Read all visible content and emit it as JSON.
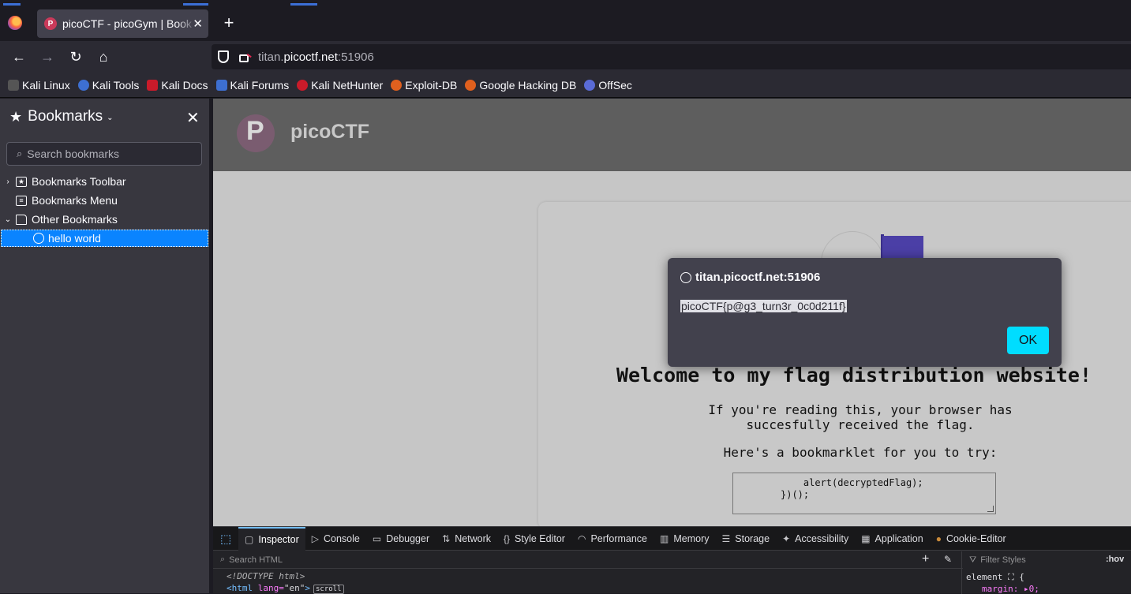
{
  "tab": {
    "title": "picoCTF - picoGym | Book",
    "favicon_letter": "P",
    "close": "✕"
  },
  "newtab": "+",
  "nav": {
    "back": "←",
    "forward": "→",
    "reload": "↻",
    "home": "⌂"
  },
  "urlbar": {
    "host_prefix": "titan.",
    "host_domain": "picoctf.net",
    "port": ":51906"
  },
  "bookmarks_toolbar": [
    {
      "label": "Kali Linux",
      "color": "#2b2a33"
    },
    {
      "label": "Kali Tools",
      "color": "#3d6fd1"
    },
    {
      "label": "Kali Docs",
      "color": "#c91b2a"
    },
    {
      "label": "Kali Forums",
      "color": "#3d6fd1"
    },
    {
      "label": "Kali NetHunter",
      "color": "#c91b2a"
    },
    {
      "label": "Exploit-DB",
      "color": "#e0601e"
    },
    {
      "label": "Google Hacking DB",
      "color": "#e0601e"
    },
    {
      "label": "OffSec",
      "color": "#5a6bd6"
    }
  ],
  "sidebar": {
    "title": "Bookmarks",
    "search_placeholder": "Search bookmarks",
    "tree": [
      {
        "label": "Bookmarks Toolbar",
        "twisty": "›"
      },
      {
        "label": "Bookmarks Menu",
        "twisty": ""
      },
      {
        "label": "Other Bookmarks",
        "twisty": "⌄"
      },
      {
        "label": "hello world"
      }
    ]
  },
  "page": {
    "site_name": "picoCTF",
    "welcome": "Welcome to my flag distribution website!",
    "para1_line1": "If you're reading this, your browser has",
    "para1_line2": "succesfully received the flag.",
    "para2": "Here's a bookmarklet for you to try:",
    "code": "    alert(decryptedFlag);\n})();"
  },
  "dialog": {
    "origin": "titan.picoctf.net:51906",
    "message": "picoCTF{p@g3_turn3r_0c0d211f}",
    "ok_label": "OK"
  },
  "devtools": {
    "tabs": [
      {
        "label": "Inspector",
        "icon": "▢"
      },
      {
        "label": "Console",
        "icon": "▷"
      },
      {
        "label": "Debugger",
        "icon": "▭"
      },
      {
        "label": "Network",
        "icon": "⇅"
      },
      {
        "label": "Style Editor",
        "icon": "{}"
      },
      {
        "label": "Performance",
        "icon": "◠"
      },
      {
        "label": "Memory",
        "icon": "▥"
      },
      {
        "label": "Storage",
        "icon": "☰"
      },
      {
        "label": "Accessibility",
        "icon": "✦"
      },
      {
        "label": "Application",
        "icon": "▦"
      },
      {
        "label": "Cookie-Editor",
        "icon": "●"
      }
    ],
    "search_placeholder": "Search HTML",
    "filter_placeholder": "Filter Styles",
    "hov": ":hov",
    "doctype": "<!DOCTYPE html>",
    "html_tag_open": "<html",
    "html_attr": " lang=",
    "html_attr_val": "\"en\"",
    "html_tag_close": ">",
    "scroll_badge": "scroll",
    "rule_selector": "element ⛶ {",
    "rule_prop": "margin: ▸0;"
  }
}
